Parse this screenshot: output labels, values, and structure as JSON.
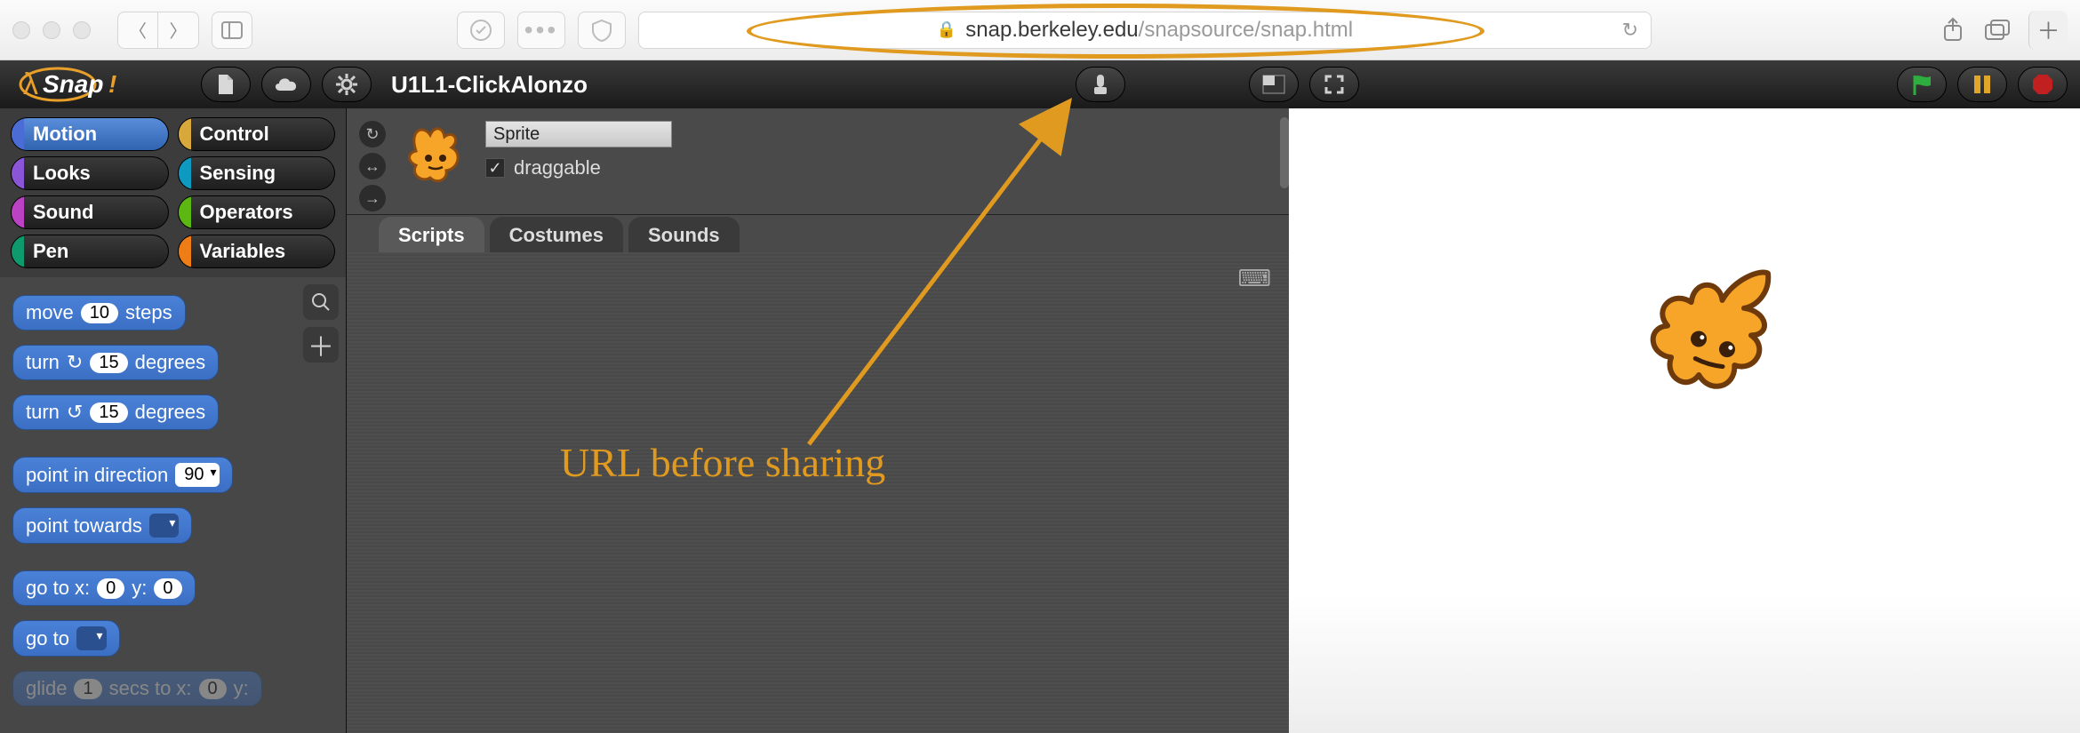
{
  "browser": {
    "url_secure_host": "snap.berkeley.edu",
    "url_path": "/snapsource/snap.html"
  },
  "snap": {
    "project_title": "U1L1-ClickAlonzo"
  },
  "categories": [
    {
      "name": "Motion",
      "color": "#4a6cd4",
      "selected": true
    },
    {
      "name": "Control",
      "color": "#d8a93a",
      "selected": false
    },
    {
      "name": "Looks",
      "color": "#8a55d7",
      "selected": false
    },
    {
      "name": "Sensing",
      "color": "#0e9ac0",
      "selected": false
    },
    {
      "name": "Sound",
      "color": "#bb42c3",
      "selected": false
    },
    {
      "name": "Operators",
      "color": "#5cb712",
      "selected": false
    },
    {
      "name": "Pen",
      "color": "#0e9a6c",
      "selected": false
    },
    {
      "name": "Variables",
      "color": "#ee7d16",
      "selected": false
    }
  ],
  "blocks": {
    "move": {
      "pre": "move",
      "val": "10",
      "post": "steps"
    },
    "turn_cw": {
      "pre": "turn",
      "val": "15",
      "post": "degrees"
    },
    "turn_ccw": {
      "pre": "turn",
      "val": "15",
      "post": "degrees"
    },
    "point_dir": {
      "pre": "point in direction",
      "val": "90"
    },
    "point_tw": {
      "pre": "point towards"
    },
    "goto_xy": {
      "pre": "go to x:",
      "x": "0",
      "mid": "y:",
      "y": "0"
    },
    "goto": {
      "pre": "go to"
    },
    "glide": {
      "pre": "glide",
      "secs": "1",
      "mid": "secs to x:",
      "x": "0",
      "mid2": "y:"
    }
  },
  "sprite": {
    "name": "Sprite",
    "draggable_label": "draggable",
    "draggable": true,
    "tabs": [
      "Scripts",
      "Costumes",
      "Sounds"
    ],
    "active_tab": "Scripts"
  },
  "annotation": {
    "text": "URL before sharing"
  }
}
